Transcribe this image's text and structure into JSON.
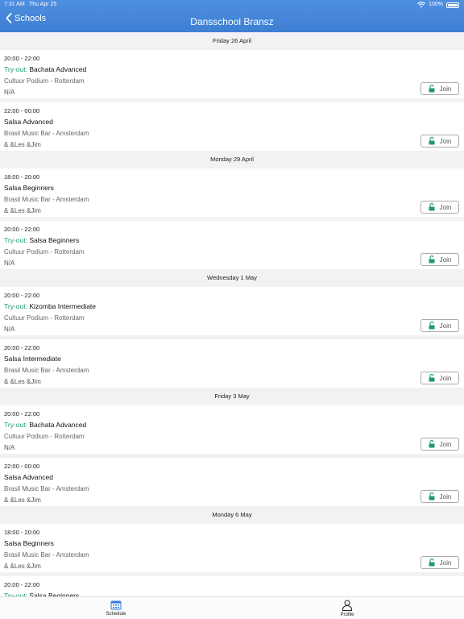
{
  "status_bar": {
    "time": "7:31 AM",
    "date": "Thu Apr 25",
    "battery": "100%"
  },
  "nav": {
    "back_label": "Schools",
    "title": "Dansschool Bransz"
  },
  "join_label": "Join",
  "tryout_prefix": "Try-out:",
  "days": [
    {
      "label": "Friday 26 April",
      "events": [
        {
          "time": "20:00 - 22:00",
          "tryout": true,
          "name": "Bachata Advanced",
          "venue": "Cultuur Podium - Rotterdam",
          "teachers": "N/A"
        },
        {
          "time": "22:00 - 00:00",
          "tryout": false,
          "name": "Salsa Advanced",
          "venue": "Brasil Music Bar - Amsterdam",
          "teachers": " & &Les &Jim"
        }
      ]
    },
    {
      "label": "Monday 29 April",
      "events": [
        {
          "time": "18:00 - 20:00",
          "tryout": false,
          "name": "Salsa Beginners",
          "venue": "Brasil Music Bar - Amsterdam",
          "teachers": " & &Les &Jim"
        },
        {
          "time": "20:00 - 22:00",
          "tryout": true,
          "name": "Salsa Beginners",
          "venue": "Cultuur Podium - Rotterdam",
          "teachers": "N/A"
        }
      ]
    },
    {
      "label": "Wednesday 1 May",
      "events": [
        {
          "time": "20:00 - 22:00",
          "tryout": true,
          "name": "Kizomba Intermediate",
          "venue": "Cultuur Podium - Rotterdam",
          "teachers": "N/A"
        },
        {
          "time": "20:00 - 22:00",
          "tryout": false,
          "name": "Salsa Intermediate",
          "venue": "Brasil Music Bar - Amsterdam",
          "teachers": " & &Les &Jim"
        }
      ]
    },
    {
      "label": "Friday 3 May",
      "events": [
        {
          "time": "20:00 - 22:00",
          "tryout": true,
          "name": "Bachata Advanced",
          "venue": "Cultuur Podium - Rotterdam",
          "teachers": "N/A"
        },
        {
          "time": "22:00 - 00:00",
          "tryout": false,
          "name": "Salsa Advanced",
          "venue": "Brasil Music Bar - Amsterdam",
          "teachers": " & &Les &Jim"
        }
      ]
    },
    {
      "label": "Monday 6 May",
      "events": [
        {
          "time": "18:00 - 20:00",
          "tryout": false,
          "name": "Salsa Beginners",
          "venue": "Brasil Music Bar - Amsterdam",
          "teachers": " & &Les &Jim"
        },
        {
          "time": "20:00 - 22:00",
          "tryout": true,
          "name": "Salsa Beginners",
          "venue": "",
          "teachers": ""
        }
      ]
    }
  ],
  "tabs": [
    {
      "label": "Schedule",
      "icon": "calendar-icon"
    },
    {
      "label": "Profile",
      "icon": "person-icon"
    }
  ],
  "colors": {
    "header": "#4287dc",
    "tryout": "#1f9a6e",
    "lock": "#1f9a6e",
    "section_bg": "#f2f2f4"
  }
}
